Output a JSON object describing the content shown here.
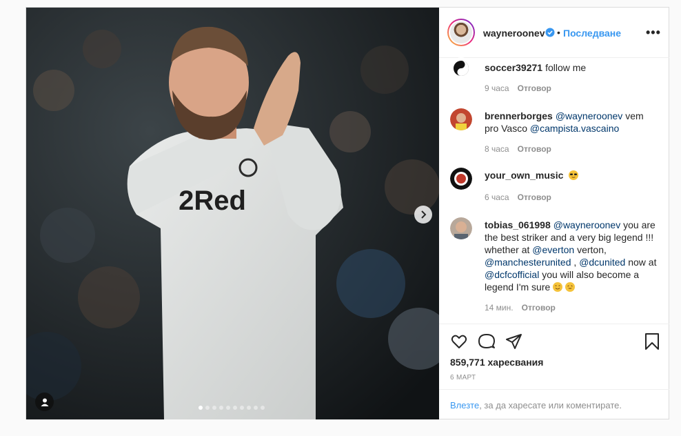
{
  "post": {
    "author": "wayneroonev",
    "follow_label": "Последване",
    "separator": "•",
    "more_label": "•••",
    "jersey_text": "2Red",
    "carousel": {
      "count": 10,
      "active_index": 0
    }
  },
  "comments": [
    {
      "user": "soccer39271",
      "parts": [
        {
          "t": "follow me",
          "m": false
        }
      ],
      "time": "9 часа",
      "reply": "Отговор"
    },
    {
      "user": "brennerborges",
      "parts": [
        {
          "t": "@wayneroonev",
          "m": true
        },
        {
          "t": " vem pro Vasco ",
          "m": false
        },
        {
          "t": "@campista.vascaino",
          "m": true
        }
      ],
      "time": "8 часа",
      "reply": "Отговор"
    },
    {
      "user": "your_own_music",
      "parts": [],
      "emoji": [
        "sunglasses"
      ],
      "time": "6 часа",
      "reply": "Отговор"
    },
    {
      "user": "tobias_061998",
      "parts": [
        {
          "t": "@wayneroonev",
          "m": true
        },
        {
          "t": " you are the best striker and a very big legend !!! whether at ",
          "m": false
        },
        {
          "t": "@everton",
          "m": true
        },
        {
          "t": " verton, ",
          "m": false
        },
        {
          "t": "@manchesterunited",
          "m": true
        },
        {
          "t": " , ",
          "m": false
        },
        {
          "t": "@dcunited",
          "m": true
        },
        {
          "t": " now at ",
          "m": false
        },
        {
          "t": "@dcfcofficial",
          "m": true
        },
        {
          "t": " you will also become a legend I'm sure ",
          "m": false
        }
      ],
      "emoji": [
        "smile",
        "grin"
      ],
      "time": "14 мин.",
      "reply": "Отговор"
    }
  ],
  "stats": {
    "likes": "859,771 харесвания",
    "date": "6 МАРТ"
  },
  "login": {
    "link": "Влезте",
    "rest": ", за да харесате или коментирате."
  },
  "colors": {
    "accent": "#3897f0",
    "mention": "#00376b",
    "muted": "#8e8e8e"
  },
  "icons": [
    "heart-icon",
    "comment-icon",
    "share-icon",
    "bookmark-icon",
    "verified-badge-icon",
    "chevron-right-icon",
    "user-tag-icon"
  ]
}
